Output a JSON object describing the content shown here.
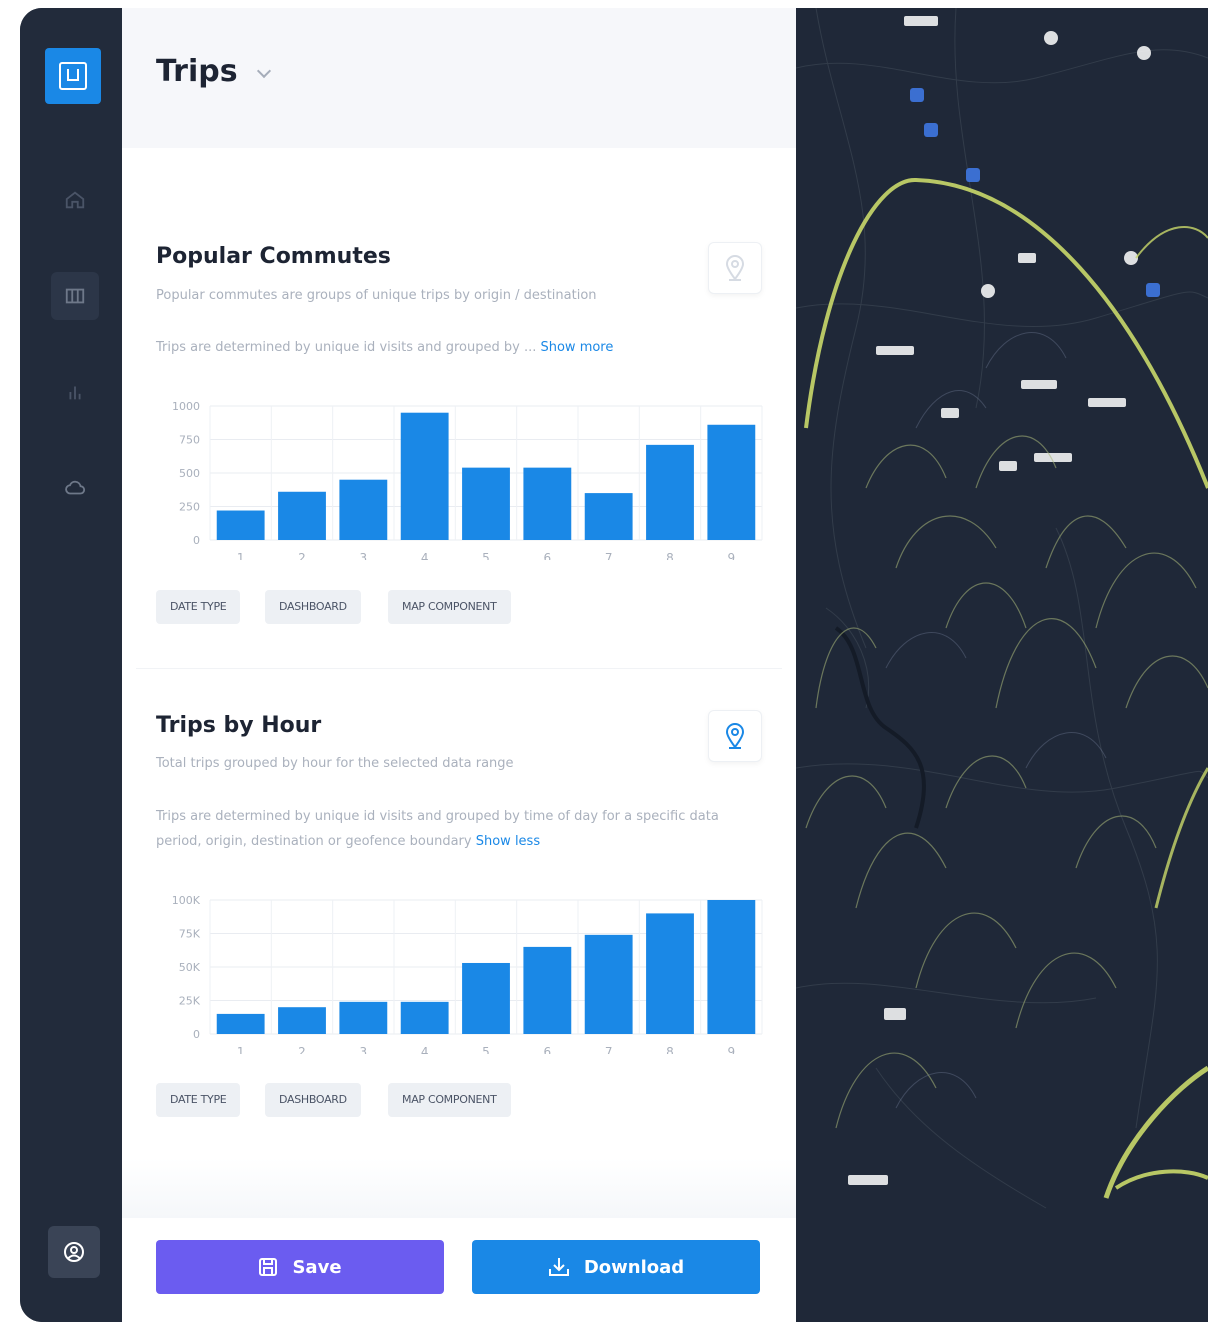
{
  "header": {
    "title": "Trips"
  },
  "sections": [
    {
      "title": "Popular Commutes",
      "subtitle": "Popular commutes are groups of unique trips by origin / destination",
      "description": "Trips are determined by unique id visits and grouped by ...",
      "toggle_label": "Show more",
      "chips": [
        "DATE TYPE",
        "DASHBOARD",
        "MAP COMPONENT"
      ]
    },
    {
      "title": "Trips by Hour",
      "subtitle": "Total trips grouped by hour for the selected data range",
      "description": "Trips are determined by unique id visits and grouped by time of day for a specific data period, origin, destination or geofence boundary",
      "toggle_label": "Show less",
      "chips": [
        "DATE TYPE",
        "DASHBOARD",
        "MAP COMPONENT"
      ]
    }
  ],
  "chart_data": [
    {
      "type": "bar",
      "categories": [
        "1",
        "2",
        "3",
        "4",
        "5",
        "6",
        "7",
        "8",
        "9"
      ],
      "values": [
        220,
        360,
        450,
        950,
        540,
        540,
        350,
        710,
        860
      ],
      "yticks": [
        "1000",
        "750",
        "500",
        "250",
        "0"
      ],
      "ylim": [
        0,
        1000
      ],
      "grid": true,
      "color": "#1a88e6"
    },
    {
      "type": "bar",
      "categories": [
        "1",
        "2",
        "3",
        "4",
        "5",
        "6",
        "7",
        "8",
        "9"
      ],
      "values": [
        15000,
        20000,
        24000,
        24000,
        53000,
        65000,
        74000,
        90000,
        100000
      ],
      "yticks": [
        "100K",
        "75K",
        "50K",
        "25K",
        "0"
      ],
      "ylim": [
        0,
        100000
      ],
      "grid": true,
      "color": "#1a88e6"
    }
  ],
  "buttons": {
    "save": "Save",
    "download": "Download"
  },
  "icons": {
    "logo": "app-logo-icon",
    "nav": [
      "home-icon",
      "map-icon",
      "bar-chart-icon",
      "cloud-icon"
    ],
    "profile": "user-circle-icon",
    "pin": "map-pin-icon"
  },
  "colors": {
    "accent": "#1a88e6",
    "save": "#6b5cf0",
    "sidebar": "#222b3b",
    "map": "#1f2838",
    "arc": "#c9d86a"
  }
}
